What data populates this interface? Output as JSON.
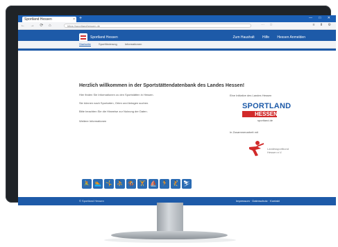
{
  "browser": {
    "tab_title": "Sportland Hessen",
    "tab_close": "×",
    "new_tab": "+",
    "window_controls": "— □ ✕",
    "nav_icons": "← → ⟳ ⌂",
    "url": "https://sportlandhessen.de",
    "url_right": "⋯ ☆",
    "tools_right": "≡ ⬇ ⚙"
  },
  "site": {
    "name": "Sportland Hessen",
    "header_links": [
      "Zum Haushalt",
      "Hilfe",
      "Hessen Anmelden"
    ],
    "subnav": [
      "Startseite",
      "Sportförderung",
      "Informationen"
    ],
    "welcome": "Herzlich willkommen in der Sportstättendatenbank des Landes Hessen!",
    "paragraphs": [
      "Hier finden Sie Informationen zu den Sportstätten in Hessen.",
      "Sie können nach Sportarten, Orten und Anlagen suchen.",
      "Bitte beachten Sie die Hinweise zur Nutzung der Daten.",
      "Weitere Informationen"
    ],
    "sponsor_text_1": "Eine Initiative des Landes Hessen",
    "sportland_word": "SPORTLAND",
    "hessen_word": "HESSEN",
    "sportland_sub": "sportland.de",
    "sponsor_text_2": "In Zusammenarbeit mit",
    "lsbh_text": "Landessportbund Hessen e.V.",
    "sport_icons": [
      "🚴",
      "🏊",
      "🤸",
      "⛹",
      "🏇",
      "🏋",
      "⛵",
      "🏃",
      "🤾",
      "⛷"
    ],
    "footer_left": "© Sportland Hessen",
    "footer_right": "Impressum · Datenschutz · Kontakt"
  },
  "colors": {
    "primary": "#1d5aa8",
    "accent_red": "#d12a2a",
    "bezel": "#1f2327"
  }
}
